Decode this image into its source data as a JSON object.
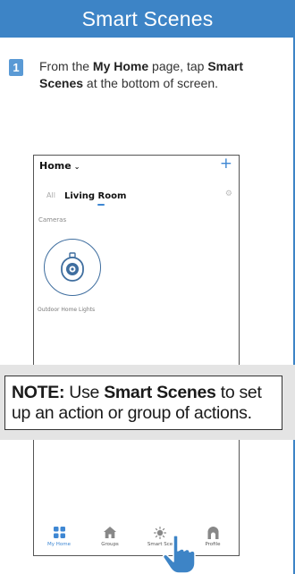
{
  "header": {
    "title": "Smart Scenes"
  },
  "step": {
    "number": "1",
    "text_1": "From the ",
    "bold_1": "My Home",
    "text_2": " page, tap ",
    "bold_2": "Smart Scenes",
    "text_3": " at the bottom of screen."
  },
  "phone": {
    "home_label": "Home",
    "tabs": [
      "All",
      "Living Room"
    ],
    "section": "Cameras",
    "device_name": "Outdoor Home Lights",
    "nav": [
      "My Home",
      "Groups",
      "Smart Scenes",
      "Profile"
    ],
    "nav_partial": "Smart Sce"
  },
  "note": {
    "label": "NOTE:",
    "text_1": " Use ",
    "bold": "Smart Scenes",
    "text_2": " to set up an action or group of actions."
  },
  "colors": {
    "brand_blue": "#3d84c6",
    "accent": "#3e87d3"
  }
}
